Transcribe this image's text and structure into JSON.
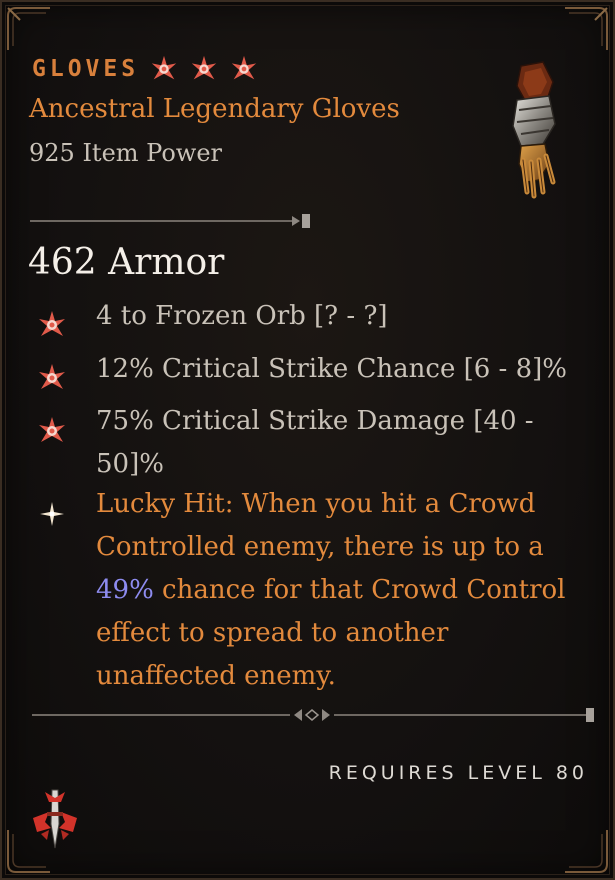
{
  "header": {
    "type_label": "GLOVES",
    "greater_affix_count": 3,
    "item_name": "Ancestral Legendary Gloves",
    "item_power": "925 Item Power",
    "item_image_icon": "gauntlet-icon"
  },
  "armor": "462 Armor",
  "affixes": [
    {
      "text": "4 to Frozen Orb [? - ?]",
      "bullet": "greater-affix-icon"
    },
    {
      "text": "12% Critical Strike Chance [6 - 8]%",
      "bullet": "greater-affix-icon"
    },
    {
      "text": "75% Critical Strike Damage [40 - 50]%",
      "bullet": "greater-affix-icon"
    }
  ],
  "legendary_aspect": {
    "bullet": "legendary-power-icon",
    "text_before": "Lucky Hit: When you hit a Crowd Controlled enemy, there is up to a ",
    "highlight": "49%",
    "text_after": " chance for that Crowd Control effect to spread to another unaffected enemy."
  },
  "requirements": {
    "text": "REQUIRES LEVEL 80"
  },
  "class_icon": "sorcerer-class-icon",
  "colors": {
    "legendary_orange": "#e38a3d",
    "highlight_purple": "#8e8cf0",
    "affix_text": "#c9c2b8",
    "armor_text": "#f4efe8"
  }
}
